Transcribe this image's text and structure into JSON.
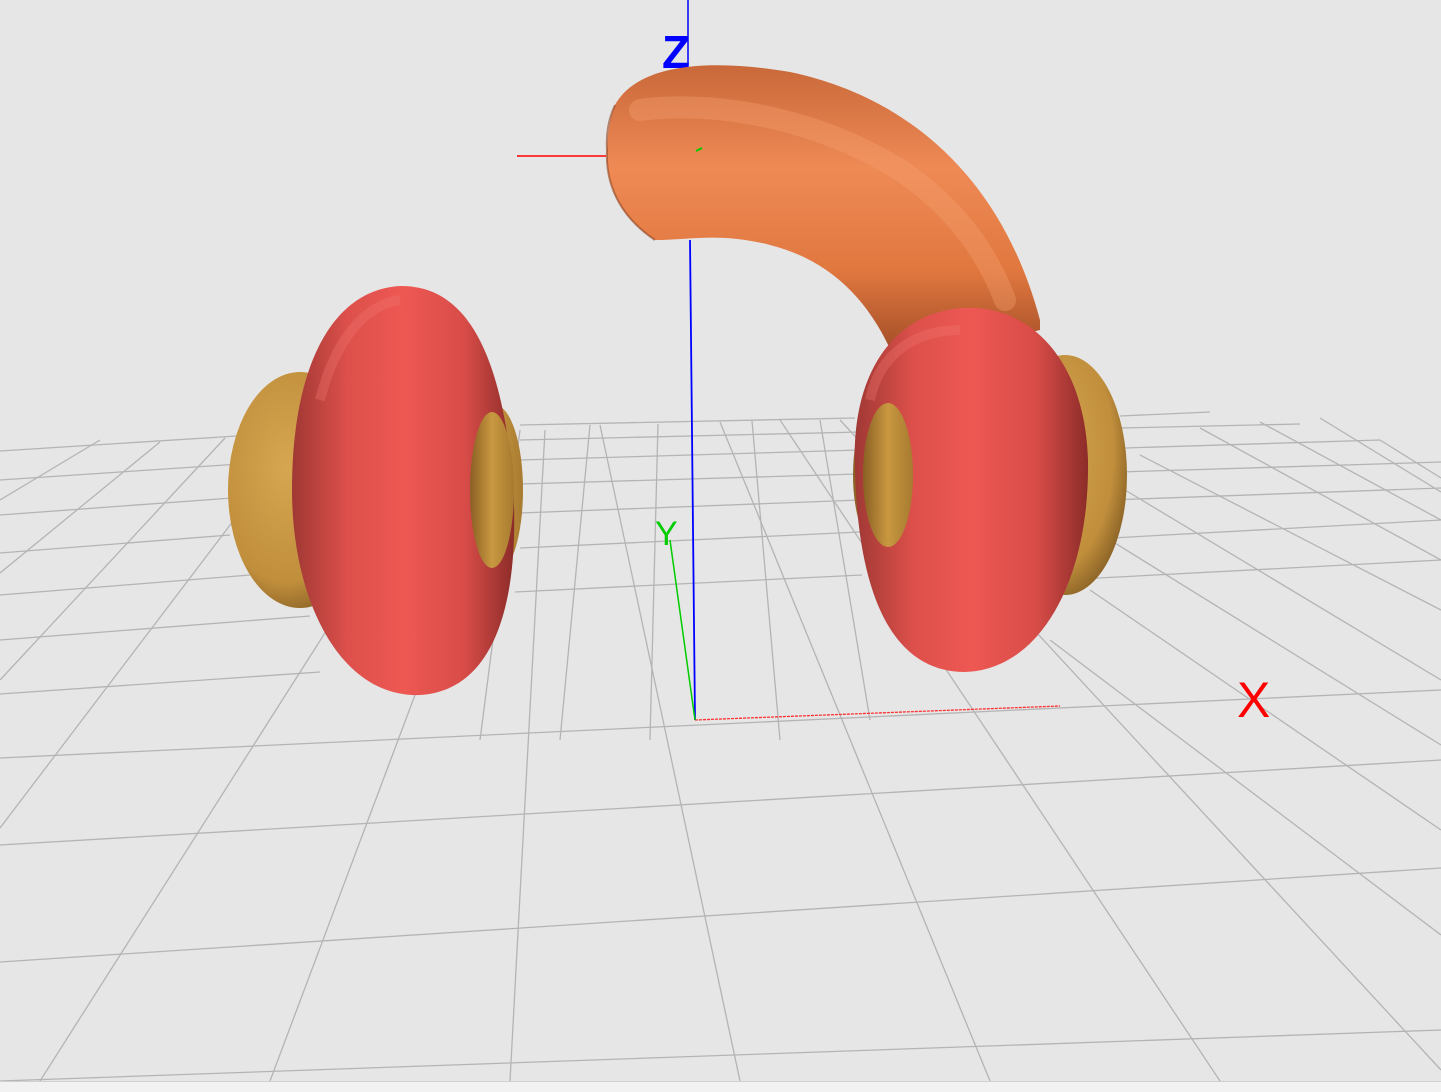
{
  "viewport": {
    "background": "#e6e6e6",
    "grid_color": "#b4b4b4"
  },
  "axes": {
    "x": {
      "label": "X",
      "color": "#ff0000"
    },
    "y": {
      "label": "Y",
      "color": "#00cc00"
    },
    "z": {
      "label": "Z",
      "color": "#0000ff"
    }
  },
  "model": {
    "headband_color": "#e8814d",
    "ear_cushion_color": "#e25550",
    "ear_cup_color": "#c7963f"
  }
}
